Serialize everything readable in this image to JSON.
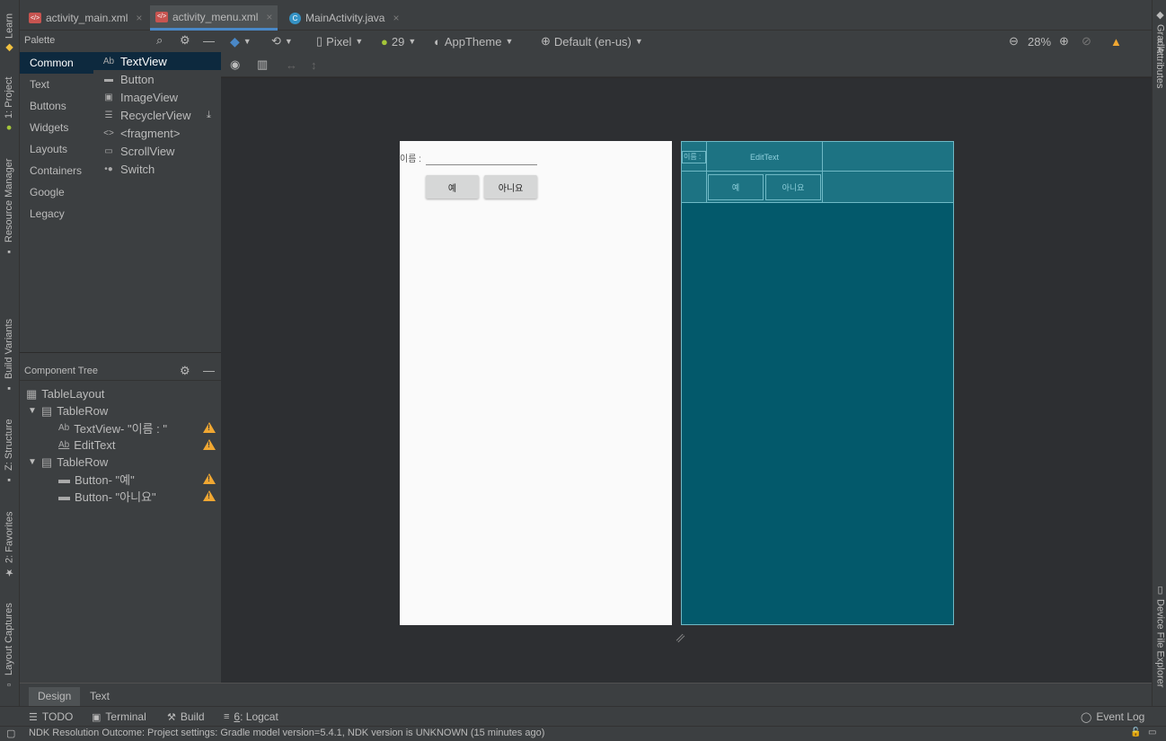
{
  "tabs": [
    {
      "label": "activity_main.xml",
      "icon": "xml-file-icon"
    },
    {
      "label": "activity_menu.xml",
      "icon": "xml-file-icon",
      "active": true
    },
    {
      "label": "MainActivity.java",
      "icon": "java-class-icon"
    }
  ],
  "left_tools": {
    "learn": "Learn",
    "project": "1: Project",
    "resource_manager": "Resource Manager",
    "build_variants": "Build Variants",
    "structure": "Z: Structure",
    "favorites": "2: Favorites",
    "layout_captures": "Layout Captures"
  },
  "right_tools": {
    "gradle": "Gradle",
    "attributes": "Attributes",
    "device_file_explorer": "Device File Explorer"
  },
  "palette": {
    "title": "Palette",
    "categories": [
      "Common",
      "Text",
      "Buttons",
      "Widgets",
      "Layouts",
      "Containers",
      "Google",
      "Legacy"
    ],
    "items": [
      {
        "label": "TextView",
        "icon": "Ab"
      },
      {
        "label": "Button",
        "icon": "button-icon"
      },
      {
        "label": "ImageView",
        "icon": "image-icon"
      },
      {
        "label": "RecyclerView",
        "icon": "list-icon"
      },
      {
        "label": "<fragment>",
        "icon": "<>"
      },
      {
        "label": "ScrollView",
        "icon": "scroll-icon"
      },
      {
        "label": "Switch",
        "icon": "switch-icon"
      }
    ]
  },
  "component_tree": {
    "title": "Component Tree",
    "nodes": [
      {
        "label": "TableLayout"
      },
      {
        "label": "TableRow"
      },
      {
        "label": "TextView- \"이름 : \""
      },
      {
        "label": "EditText"
      },
      {
        "label": "TableRow"
      },
      {
        "label": "Button- \"예\""
      },
      {
        "label": "Button- \"아니요\""
      }
    ]
  },
  "toolbar": {
    "device": "Pixel",
    "api": "29",
    "theme": "AppTheme",
    "locale": "Default (en-us)",
    "zoom": "28%"
  },
  "preview": {
    "name_label": "이름 :",
    "yes_button": "예",
    "no_button": "아니요"
  },
  "blueprint": {
    "name_label": "이름 :",
    "edittext": "EditText",
    "yes_button": "예",
    "no_button": "아니요"
  },
  "editor_tabs": {
    "design": "Design",
    "text": "Text"
  },
  "bottom_tools": {
    "todo": "TODO",
    "terminal": "Terminal",
    "build": "Build",
    "logcat_num": "6",
    "logcat": ": Logcat",
    "event_log": "Event Log"
  },
  "status": "NDK Resolution Outcome: Project settings: Gradle model version=5.4.1, NDK version is UNKNOWN (15 minutes ago)",
  "colors": {
    "accent": "#4a88c7",
    "warning": "#f0a732",
    "blueprint": "#03596b"
  }
}
